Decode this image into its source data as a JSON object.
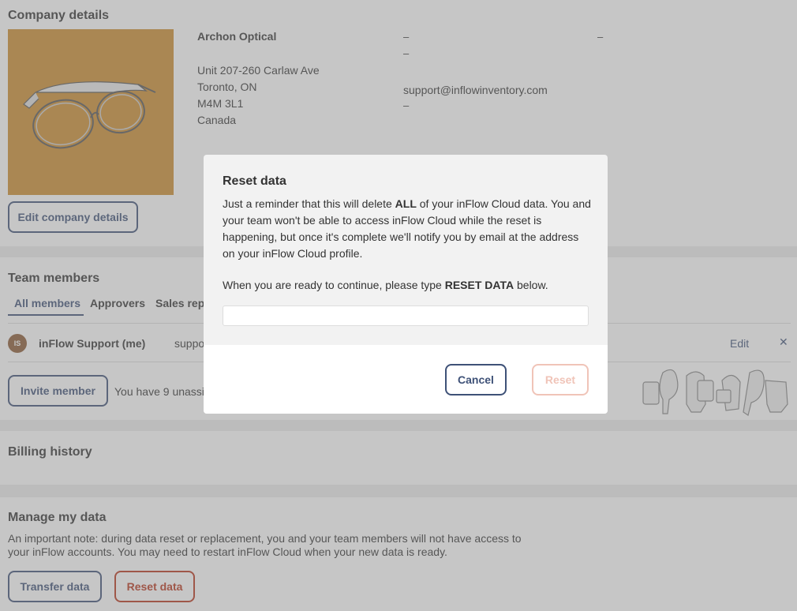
{
  "company": {
    "title": "Company details",
    "name": "Archon Optical",
    "address": [
      "Unit 207-260 Carlaw Ave",
      "Toronto, ON",
      "M4M 3L1",
      "Canada"
    ],
    "dash": "–",
    "email": "support@inflowinventory.com",
    "edit_label": "Edit company details"
  },
  "team": {
    "title": "Team members",
    "tabs": [
      "All members",
      "Approvers",
      "Sales reps"
    ],
    "member": {
      "initials": "IS",
      "name": "inFlow Support (me)",
      "email": "support@inflowinventory.com",
      "edit": "Edit",
      "remove": "✕"
    },
    "invite_label": "Invite member",
    "unassigned_text": "You have 9 unassigned seats"
  },
  "billing": {
    "title": "Billing history"
  },
  "manage": {
    "title": "Manage my data",
    "note": "An important note: during data reset or replacement, you and your team members will not have access to your inFlow accounts. You may need to restart inFlow Cloud when your new data is ready.",
    "transfer_label": "Transfer data",
    "reset_label": "Reset data"
  },
  "modal": {
    "title": "Reset data",
    "text_a": "Just a reminder that this will delete ",
    "text_b": "ALL",
    "text_c": " of your inFlow Cloud data. You and your team won't be able to access inFlow Cloud while the reset is happening, but once it's complete we'll notify you by email at the address on your inFlow Cloud profile.",
    "confirm_a": "When you are ready to continue, please type ",
    "confirm_b": "RESET DATA",
    "confirm_c": " below.",
    "input_value": "",
    "cancel_label": "Cancel",
    "reset_label": "Reset"
  },
  "colors": {
    "accent": "#3e5177",
    "danger": "#b8361c",
    "logo_bg": "#cc8c2e"
  }
}
